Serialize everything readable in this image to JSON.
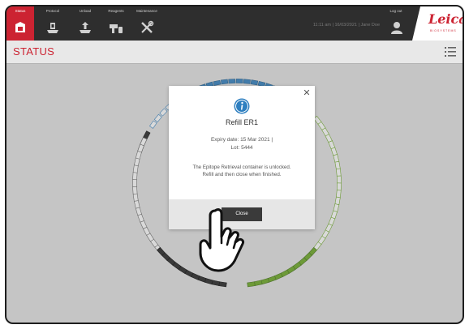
{
  "topbar": {
    "nav": [
      {
        "label": "Status",
        "icon": "instrument-icon",
        "active": true
      },
      {
        "label": "Protocol",
        "icon": "protocol-tray-icon",
        "active": false
      },
      {
        "label": "Unload",
        "icon": "unload-tray-icon",
        "active": false
      },
      {
        "label": "Reagents",
        "icon": "reagent-bottle-icon",
        "active": false
      },
      {
        "label": "Maintenance",
        "icon": "tools-icon",
        "active": false
      }
    ],
    "status_line": "11:11 am  |  16/03/2021  |  Jane Doe",
    "logout_label": "Log out",
    "logo_text": "Leica",
    "logo_sub": "BIOSYSTEMS"
  },
  "page": {
    "title": "STATUS"
  },
  "dialog": {
    "title": "Refill ER1",
    "expiry_line": "Expiry date: 15 Mar 2021  |",
    "lot_line": "Lot: 5444",
    "message": "The Epitope Retrieval container is unlocked. Refill and then close when finished.",
    "close_label": "Close"
  },
  "colors": {
    "accent": "#cc2332",
    "topbar": "#2e2e2e",
    "ring_blue": "#2e7fc0",
    "ring_green": "#6aa820",
    "ring_dark": "#222222"
  }
}
